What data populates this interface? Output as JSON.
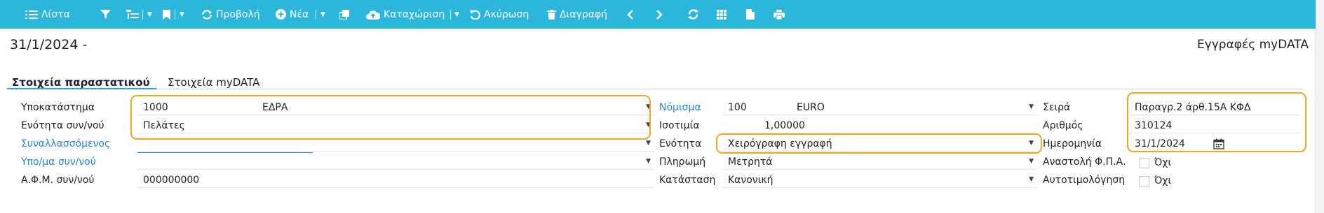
{
  "toolbar": {
    "list": "Λίστα",
    "view": "Προβολή",
    "new": "Νέα",
    "record": "Καταχώριση",
    "cancel": "Ακύρωση",
    "delete": "Διαγραφή"
  },
  "header": {
    "date_title": "31/1/2024 -",
    "records_title": "Εγγραφές myDATA"
  },
  "tabs": [
    {
      "label": "Στοιχεία παραστατικού",
      "active": true
    },
    {
      "label": "Στοιχεία myDATA",
      "active": false
    }
  ],
  "form": {
    "branch": {
      "label": "Υποκατάστημα",
      "code": "1000",
      "name": "ΕΔΡΑ"
    },
    "partner_unit": {
      "label": "Ενότητα συν/νού",
      "value": "Πελάτες"
    },
    "partner": {
      "label": "Συναλλασσόμενος",
      "value": ""
    },
    "partner_branch": {
      "label": "Υπο/μα συν/νού",
      "value": ""
    },
    "partner_vat": {
      "label": "Α.Φ.Μ. συν/νού",
      "value": "000000000"
    },
    "currency": {
      "label": "Νόμισμα",
      "code": "100",
      "name": "EURO"
    },
    "rate": {
      "label": "Ισοτιμία",
      "value": "1,00000"
    },
    "section": {
      "label": "Ενότητα",
      "value": "Χειρόγραφη εγγραφή"
    },
    "payment": {
      "label": "Πληρωμή",
      "value": "Μετρητά"
    },
    "status": {
      "label": "Κατάσταση",
      "value": "Κανονική"
    },
    "series": {
      "label": "Σειρά",
      "value": "Παραγρ.2 άρθ.15Α ΚΦΔ"
    },
    "number": {
      "label": "Αριθμός",
      "value": "310124"
    },
    "date": {
      "label": "Ημερομηνία",
      "value": "31/1/2024"
    },
    "vat_suspension": {
      "label": "Αναστολή Φ.Π.Α.",
      "value": "Όχι"
    },
    "self_billing": {
      "label": "Αυτοτιμολόγηση",
      "value": "Όχι"
    }
  },
  "colors": {
    "toolbar_bg": "#2bb6dc",
    "highlight": "#f0a81c",
    "link": "#2a86c9"
  }
}
